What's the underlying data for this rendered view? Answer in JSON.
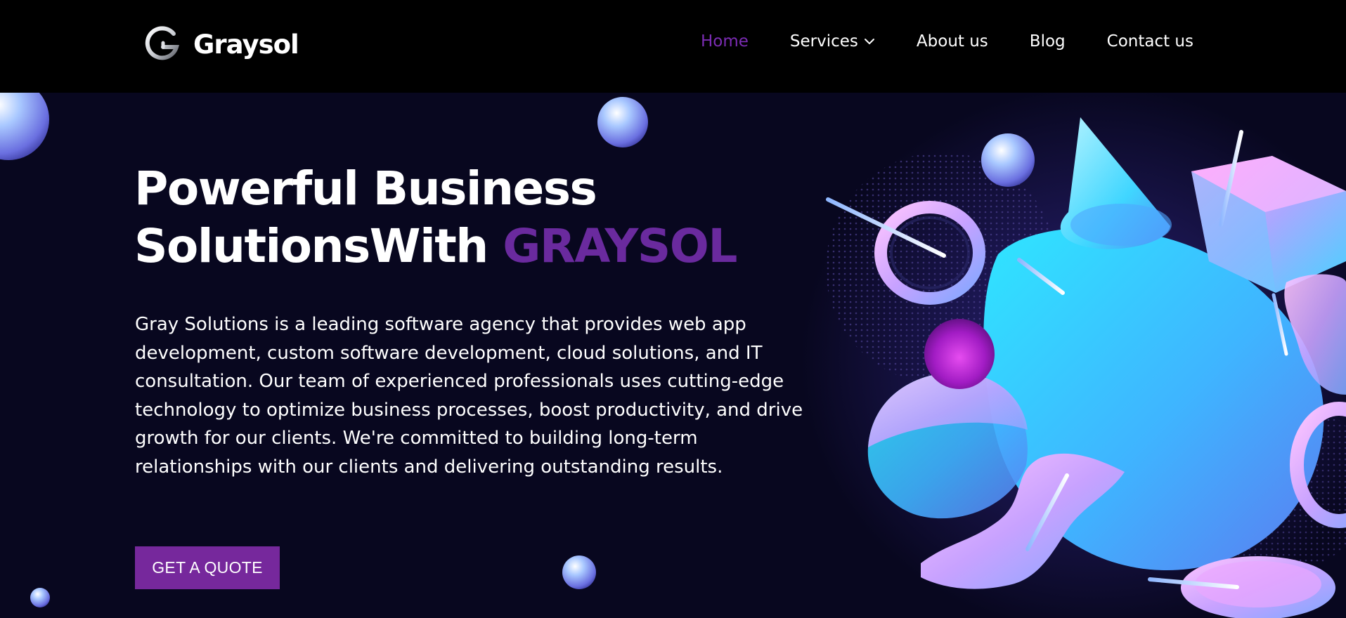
{
  "brand": {
    "name": "Graysol",
    "logo_icon": "graysol-g-logo-icon"
  },
  "nav": {
    "items": [
      {
        "label": "Home",
        "active": true
      },
      {
        "label": "Services",
        "active": false,
        "icon": "chevron-down-icon"
      },
      {
        "label": "About us",
        "active": false
      },
      {
        "label": "Blog",
        "active": false
      },
      {
        "label": "Contact us",
        "active": false
      }
    ]
  },
  "hero": {
    "title_line1": "Powerful Business",
    "title_line2": "SolutionsWith ",
    "title_accent": "GRAYSOL",
    "description": "Gray Solutions is a leading software agency that provides web app development, custom software development, cloud solutions, and IT consultation. Our team of experienced professionals uses cutting-edge technology to optimize business processes, boost productivity, and drive growth for our clients. We're committed to building long-term relationships with our clients and delivering outstanding results.",
    "cta_label": "GET A QUOTE"
  },
  "colors": {
    "header_bg": "#000000",
    "hero_bg": "#08071f",
    "accent_purple": "#76289c",
    "nav_active": "#7b2cb3",
    "shape_cyan": "#3fd4ff",
    "shape_pink": "#f0a8ff"
  }
}
